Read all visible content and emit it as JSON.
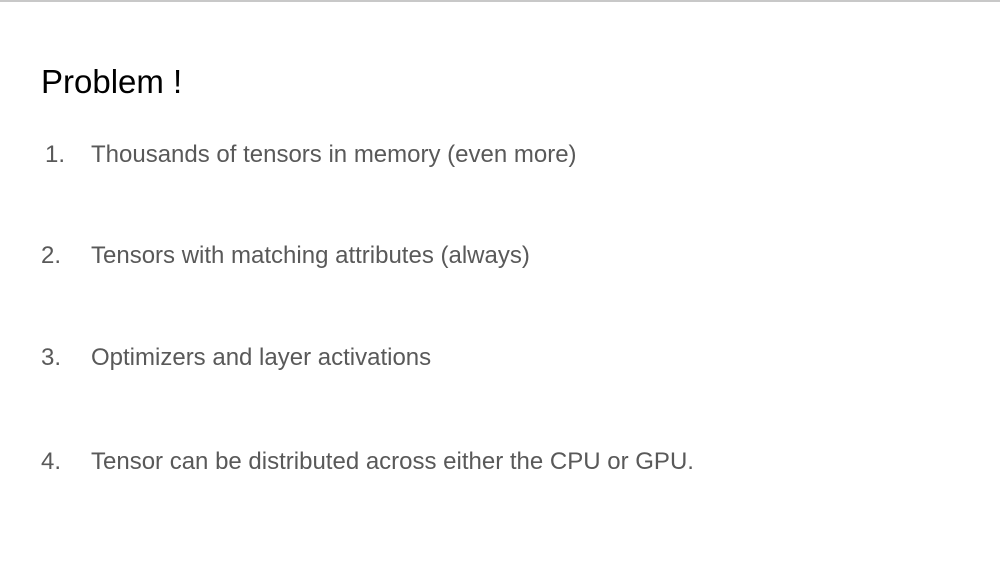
{
  "slide": {
    "title": "Problem !",
    "items": [
      {
        "number": "1.",
        "text": "Thousands of tensors in memory (even more)"
      },
      {
        "number": "2.",
        "text": "Tensors with matching attributes (always)"
      },
      {
        "number": "3.",
        "text": "Optimizers and layer activations"
      },
      {
        "number": "4.",
        "text": "Tensor can be distributed across either the CPU or GPU."
      }
    ]
  },
  "colors": {
    "background": "#ffffff",
    "title": "#000000",
    "body_text": "#595959",
    "top_rule": "#c8c8c8"
  }
}
